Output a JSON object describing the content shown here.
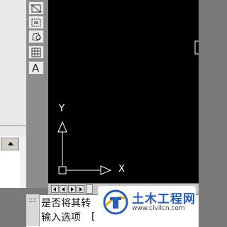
{
  "viewport": {
    "ucs_y_label": "Y",
    "ucs_x_label": "X"
  },
  "toolbar": {
    "icons": [
      "rectangle-dimension-icon",
      "region-icon",
      "polygon-icon",
      "table-icon",
      "text-icon"
    ],
    "text_tool_label": "A"
  },
  "command_line": {
    "line1": "是否将其转",
    "line2": "输入选项",
    "bracket": "["
  },
  "watermark": {
    "title": "土木工程网",
    "url": "www.civilcn.com"
  },
  "colors": {
    "viewport_bg": "#000000",
    "watermark_blue": "#1e5bb8"
  }
}
